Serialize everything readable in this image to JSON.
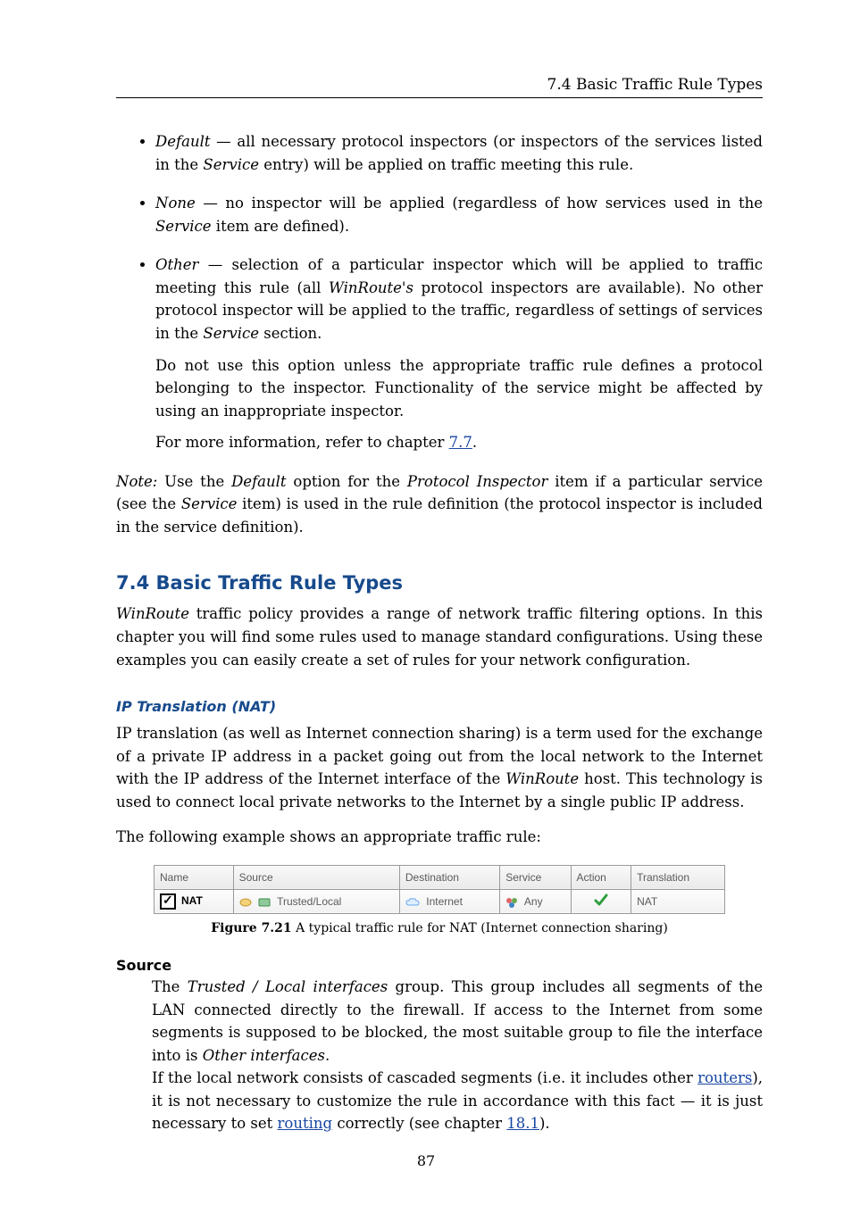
{
  "running_head": "7.4 Basic Traffic Rule Types",
  "bullets": {
    "default_lead": "Default",
    "default_rest": " — all necessary protocol inspectors (or inspectors of the services listed in the ",
    "default_service": "Service",
    "default_tail": " entry) will be applied on traffic meeting this rule.",
    "none_lead": "None",
    "none_rest": " — no inspector will be applied (regardless of how services used in the ",
    "none_service": "Service",
    "none_tail": " item are defined).",
    "other_lead": "Other",
    "other_p1a": " — selection of a particular inspector which will be applied to traffic meeting this rule (all ",
    "other_winroute": "WinRoute's",
    "other_p1b": " protocol inspectors are available). No other protocol inspector will be applied to the traffic, regardless of settings of services in the ",
    "other_service": "Service",
    "other_p1c": " section.",
    "other_p2": "Do not use this option unless the appropriate traffic rule defines a protocol belonging to the inspector. Functionality of the service might be affected by using an inappropriate inspector.",
    "other_p3_pre": "For more information, refer to chapter ",
    "other_p3_link": "7.7",
    "other_p3_post": "."
  },
  "note_para": {
    "lead": "Note:",
    "a": " Use the ",
    "default": "Default",
    "b": " option for the ",
    "pi": "Protocol Inspector",
    "c": " item if a particular service (see the ",
    "service": "Service",
    "d": " item) is used in the rule definition (the protocol inspector is included in the service definition)."
  },
  "section_title": "7.4 Basic Traffic Rule Types",
  "section_para_a": "WinRoute",
  "section_para_b": " traffic policy provides a range of network traffic filtering options. In this chapter you will find some rules used to manage standard configurations. Using these examples you can easily create a set of rules for your network configuration.",
  "nat_heading": "IP Translation (NAT)",
  "nat_para_a": "IP translation (as well as Internet connection sharing) is a term used for the exchange of a private IP address in a packet going out from the local network to the Internet with the IP address of the Internet interface of the ",
  "nat_para_wr": "WinRoute",
  "nat_para_b": " host. This technology is used to connect local private networks to the Internet by a single public IP address.",
  "nat_para2": "The following example shows an appropriate traffic rule:",
  "table": {
    "headers": [
      "Name",
      "Source",
      "Destination",
      "Service",
      "Action",
      "Translation"
    ],
    "row": {
      "name": "NAT",
      "source": "Trusted/Local",
      "destination": "Internet",
      "service": "Any",
      "translation": "NAT"
    }
  },
  "figure_caption_bold": "Figure 7.21",
  "figure_caption_rest": "   A typical traffic rule for NAT (Internet connection sharing)",
  "source_heading": "Source",
  "source_p1_a": "The ",
  "source_p1_ital": "Trusted / Local interfaces",
  "source_p1_b": " group. This group includes all segments of the LAN connected directly to the firewall. If access to the Internet from some segments is supposed to be blocked, the most suitable group to file the interface into is ",
  "source_p1_ital2": "Other interfaces",
  "source_p1_c": ".",
  "source_p2_a": "If the local network consists of cascaded segments (i.e. it includes other ",
  "source_p2_link1": "routers",
  "source_p2_b": "), it is not necessary to customize the rule in accordance with this fact — it is just necessary to set ",
  "source_p2_link2": "routing",
  "source_p2_c": " correctly (see chapter ",
  "source_p2_link3": "18.1",
  "source_p2_d": ").",
  "page_number": "87"
}
